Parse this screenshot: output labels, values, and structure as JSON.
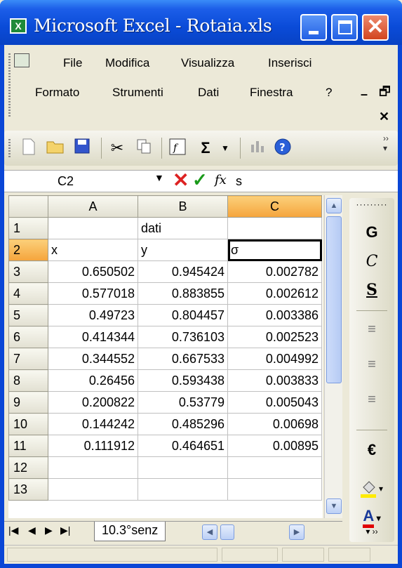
{
  "window": {
    "title": "Microsoft Excel - Rotaia.xls",
    "app_icon": "excel-icon"
  },
  "menu": {
    "row1": [
      "File",
      "Modifica",
      "Visualizza",
      "Inserisci"
    ],
    "row2": [
      "Formato",
      "Strumenti",
      "Dati",
      "Finestra",
      "?"
    ]
  },
  "toolbar": {
    "icons": [
      "new-icon",
      "open-icon",
      "save-icon",
      "cut-icon",
      "copy-icon",
      "paste-function-icon",
      "autosum-icon",
      "chart-icon",
      "help-icon"
    ],
    "autosum_glyph": "Σ"
  },
  "formula_bar": {
    "name_box": "C2",
    "fx": "fx",
    "content": "s"
  },
  "grid": {
    "columns": [
      "A",
      "B",
      "C"
    ],
    "selected_column": "C",
    "selected_row": "2",
    "rows": [
      {
        "n": "1",
        "A": "",
        "B": "dati",
        "C": ""
      },
      {
        "n": "2",
        "A": "x",
        "B": "y",
        "C": "σ"
      },
      {
        "n": "3",
        "A": "0.650502",
        "B": "0.945424",
        "C": "0.002782"
      },
      {
        "n": "4",
        "A": "0.577018",
        "B": "0.883855",
        "C": "0.002612"
      },
      {
        "n": "5",
        "A": "0.49723",
        "B": "0.804457",
        "C": "0.003386"
      },
      {
        "n": "6",
        "A": "0.414344",
        "B": "0.736103",
        "C": "0.002523"
      },
      {
        "n": "7",
        "A": "0.344552",
        "B": "0.667533",
        "C": "0.004992"
      },
      {
        "n": "8",
        "A": "0.26456",
        "B": "0.593438",
        "C": "0.003833"
      },
      {
        "n": "9",
        "A": "0.200822",
        "B": "0.53779",
        "C": "0.005043"
      },
      {
        "n": "10",
        "A": "0.144242",
        "B": "0.485296",
        "C": "0.00698"
      },
      {
        "n": "11",
        "A": "0.111912",
        "B": "0.464651",
        "C": "0.00895"
      },
      {
        "n": "12",
        "A": "",
        "B": "",
        "C": ""
      },
      {
        "n": "13",
        "A": "",
        "B": "",
        "C": ""
      }
    ]
  },
  "format_toolbar": {
    "bold": "G",
    "italic": "C",
    "underline": "S",
    "currency": "€",
    "font_color": "A"
  },
  "sheet_tabs": {
    "active": "10.3°senz"
  },
  "colors": {
    "title_blue": "#0a4bd8",
    "selected_header": "#f5a43c"
  }
}
